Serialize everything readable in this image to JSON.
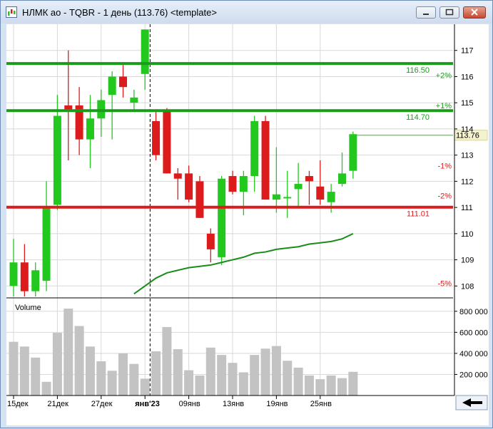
{
  "window": {
    "title": "НЛМК ао - TQBR - 1 день (113.76) <template>"
  },
  "chart_data": {
    "type": "candlestick",
    "price_axis": {
      "ylim": [
        107.6,
        118.0
      ],
      "ticks": [
        108,
        109,
        110,
        111,
        112,
        113,
        114,
        115,
        116,
        117
      ]
    },
    "volume_panel": {
      "title": "Volume",
      "ylim": [
        0,
        900000
      ],
      "ticks": [
        200000,
        400000,
        600000,
        800000
      ],
      "tick_labels": [
        "200 000",
        "400 000",
        "600 000",
        "800 000"
      ]
    },
    "x_labels": [
      {
        "i": 0,
        "text": "15дек",
        "bold": false
      },
      {
        "i": 4,
        "text": "21дек",
        "bold": false
      },
      {
        "i": 8,
        "text": "27дек",
        "bold": false
      },
      {
        "i": 12,
        "text": "янв'23",
        "bold": true
      },
      {
        "i": 16,
        "text": "09янв",
        "bold": false
      },
      {
        "i": 20,
        "text": "13янв",
        "bold": false
      },
      {
        "i": 24,
        "text": "19янв",
        "bold": false
      },
      {
        "i": 28,
        "text": "25янв",
        "bold": false
      }
    ],
    "candles": [
      {
        "o": 108.0,
        "h": 109.8,
        "l": 107.5,
        "c": 108.9
      },
      {
        "o": 108.9,
        "h": 109.6,
        "l": 107.6,
        "c": 107.8
      },
      {
        "o": 107.8,
        "h": 108.9,
        "l": 107.5,
        "c": 108.6
      },
      {
        "o": 108.2,
        "h": 112.0,
        "l": 107.8,
        "c": 111.0
      },
      {
        "o": 111.1,
        "h": 115.3,
        "l": 110.9,
        "c": 114.5
      },
      {
        "o": 114.9,
        "h": 117.0,
        "l": 112.8,
        "c": 114.7
      },
      {
        "o": 114.9,
        "h": 115.6,
        "l": 113.0,
        "c": 113.6
      },
      {
        "o": 113.6,
        "h": 115.3,
        "l": 112.5,
        "c": 114.4
      },
      {
        "o": 114.4,
        "h": 115.5,
        "l": 113.7,
        "c": 115.1
      },
      {
        "o": 115.3,
        "h": 116.2,
        "l": 113.6,
        "c": 116.0
      },
      {
        "o": 116.0,
        "h": 116.5,
        "l": 115.2,
        "c": 115.6
      },
      {
        "o": 115.0,
        "h": 115.5,
        "l": 114.7,
        "c": 115.2
      },
      {
        "o": 116.1,
        "h": 117.8,
        "l": 115.5,
        "c": 117.8
      },
      {
        "o": 114.3,
        "h": 114.7,
        "l": 112.8,
        "c": 113.0
      },
      {
        "o": 114.7,
        "h": 114.8,
        "l": 112.3,
        "c": 112.3
      },
      {
        "o": 112.3,
        "h": 112.5,
        "l": 111.3,
        "c": 112.1
      },
      {
        "o": 112.3,
        "h": 112.6,
        "l": 111.2,
        "c": 111.3
      },
      {
        "o": 112.0,
        "h": 112.2,
        "l": 110.6,
        "c": 110.6
      },
      {
        "o": 110.0,
        "h": 110.2,
        "l": 108.9,
        "c": 109.4
      },
      {
        "o": 109.1,
        "h": 112.2,
        "l": 108.8,
        "c": 112.1
      },
      {
        "o": 112.2,
        "h": 112.4,
        "l": 111.5,
        "c": 111.6
      },
      {
        "o": 111.6,
        "h": 112.4,
        "l": 110.7,
        "c": 112.2
      },
      {
        "o": 112.2,
        "h": 114.5,
        "l": 111.6,
        "c": 114.3
      },
      {
        "o": 114.3,
        "h": 114.5,
        "l": 111.3,
        "c": 111.3
      },
      {
        "o": 111.3,
        "h": 113.3,
        "l": 110.8,
        "c": 111.5
      },
      {
        "o": 111.4,
        "h": 112.4,
        "l": 110.6,
        "c": 111.4
      },
      {
        "o": 111.7,
        "h": 112.7,
        "l": 111.0,
        "c": 111.9
      },
      {
        "o": 112.2,
        "h": 112.4,
        "l": 111.1,
        "c": 112.0
      },
      {
        "o": 111.8,
        "h": 112.8,
        "l": 111.1,
        "c": 111.3
      },
      {
        "o": 111.2,
        "h": 111.9,
        "l": 110.8,
        "c": 111.6
      },
      {
        "o": 111.9,
        "h": 113.1,
        "l": 111.8,
        "c": 112.3
      },
      {
        "o": 112.4,
        "h": 113.9,
        "l": 112.1,
        "c": 113.8
      }
    ],
    "volume": [
      510000,
      465000,
      360000,
      130000,
      595000,
      825000,
      660000,
      465000,
      325000,
      235000,
      400000,
      300000,
      160000,
      420000,
      650000,
      440000,
      240000,
      190000,
      455000,
      385000,
      310000,
      220000,
      385000,
      445000,
      470000,
      330000,
      265000,
      190000,
      155000,
      190000,
      165000,
      225000
    ],
    "ma_line": [
      {
        "i": 11,
        "v": 107.7
      },
      {
        "i": 12,
        "v": 108.0
      },
      {
        "i": 13,
        "v": 108.3
      },
      {
        "i": 14,
        "v": 108.5
      },
      {
        "i": 15,
        "v": 108.6
      },
      {
        "i": 16,
        "v": 108.7
      },
      {
        "i": 17,
        "v": 108.75
      },
      {
        "i": 18,
        "v": 108.8
      },
      {
        "i": 19,
        "v": 108.9
      },
      {
        "i": 20,
        "v": 109.0
      },
      {
        "i": 21,
        "v": 109.1
      },
      {
        "i": 22,
        "v": 109.25
      },
      {
        "i": 23,
        "v": 109.3
      },
      {
        "i": 24,
        "v": 109.4
      },
      {
        "i": 25,
        "v": 109.45
      },
      {
        "i": 26,
        "v": 109.5
      },
      {
        "i": 27,
        "v": 109.6
      },
      {
        "i": 28,
        "v": 109.65
      },
      {
        "i": 29,
        "v": 109.7
      },
      {
        "i": 30,
        "v": 109.8
      },
      {
        "i": 31,
        "v": 110.0
      }
    ],
    "levels": [
      {
        "value": 116.5,
        "label": "116.50",
        "color": "#1a9c1a"
      },
      {
        "value": 114.7,
        "label": "114.70",
        "color": "#1a9c1a"
      },
      {
        "value": 111.01,
        "label": "111.01",
        "color": "#dc1c1c"
      }
    ],
    "pct_markers": [
      {
        "value": 116.05,
        "label": "+2%",
        "color": "#1a9c1a"
      },
      {
        "value": 114.9,
        "label": "+1%",
        "color": "#1a9c1a"
      },
      {
        "value": 112.6,
        "label": "-1%",
        "color": "#dc1c1c"
      },
      {
        "value": 111.45,
        "label": "-2%",
        "color": "#dc1c1c"
      },
      {
        "value": 108.1,
        "label": "-5%",
        "color": "#dc1c1c"
      }
    ],
    "last_price": {
      "value": 113.76,
      "label": "113.76"
    },
    "separator_index": 12,
    "colors": {
      "up": "#22c81e",
      "down": "#dc1c1c",
      "volume": "#c3c3c3",
      "ma": "#1a8c1a",
      "grid": "#d8d8d8"
    }
  }
}
